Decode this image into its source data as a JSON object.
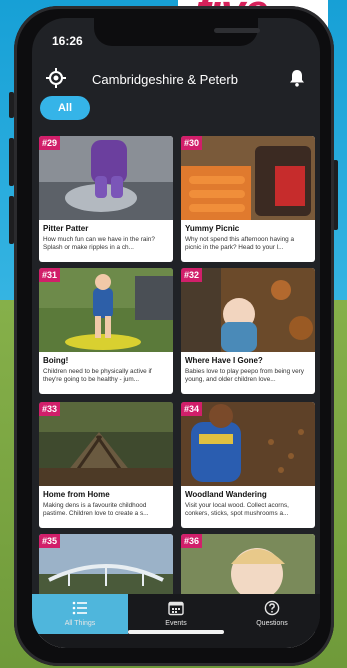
{
  "status_bar": {
    "time": "16:26"
  },
  "header": {
    "region": "Cambridgeshire & Peterb"
  },
  "filter": {
    "chip_label": "All"
  },
  "brand": {
    "logo_text": "five"
  },
  "cards": [
    {
      "num": "#29",
      "title": "Pitter Patter",
      "desc": "How much fun can we have in the rain? Splash or make ripples in a ch..."
    },
    {
      "num": "#30",
      "title": "Yummy Picnic",
      "desc": "Why not spend this afternoon having a picnic in the park? Head to your l..."
    },
    {
      "num": "#31",
      "title": "Boing!",
      "desc": "Children need to be physically active if they're going to be healthy - jum..."
    },
    {
      "num": "#32",
      "title": "Where Have I Gone?",
      "desc": "Babies love to play peepo from being very young, and older children love..."
    },
    {
      "num": "#33",
      "title": "Home from Home",
      "desc": "Making dens is a favourite childhood pastime. Children love to create a s..."
    },
    {
      "num": "#34",
      "title": "Woodland Wandering",
      "desc": "Visit your local wood. Collect acorns, conkers, sticks, spot mushrooms a..."
    },
    {
      "num": "#35",
      "title": "",
      "desc": ""
    },
    {
      "num": "#36",
      "title": "",
      "desc": ""
    }
  ],
  "tabs": [
    {
      "label": "All Things"
    },
    {
      "label": "Events"
    },
    {
      "label": "Questions"
    }
  ],
  "colors": {
    "accent": "#35b4e8",
    "badge": "#d11f6a",
    "active_tab": "#4fb6dc"
  }
}
